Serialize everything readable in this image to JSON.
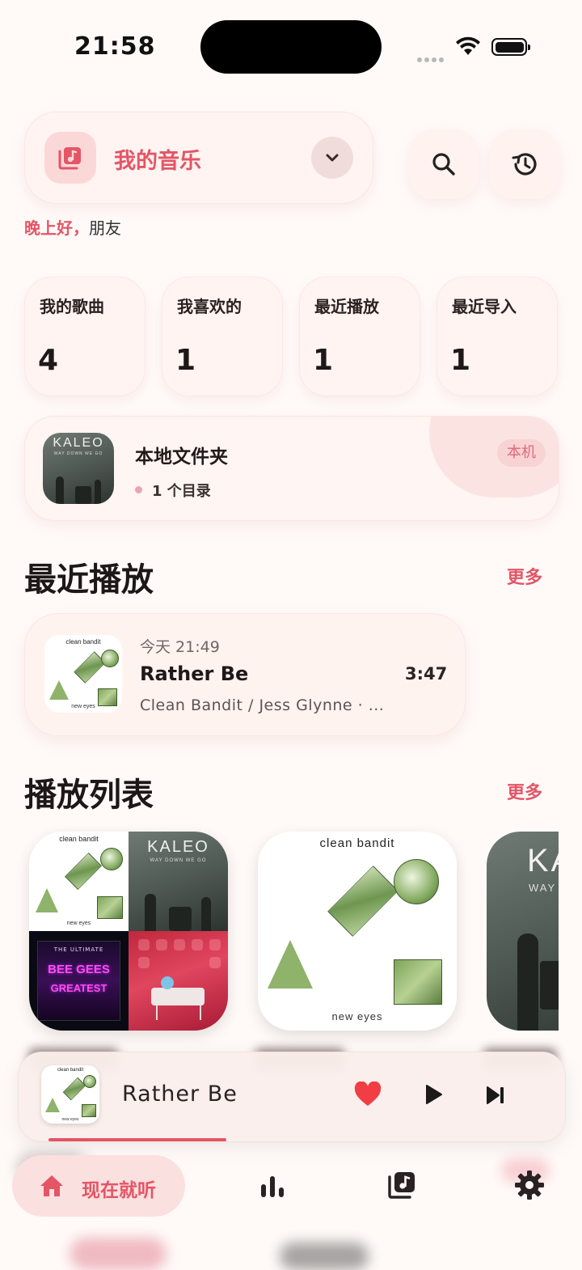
{
  "status_bar": {
    "time": "21:58"
  },
  "header": {
    "title": "我的音乐",
    "greeting_prefix": "晚上好，",
    "greeting_name": "朋友"
  },
  "stats": [
    {
      "label": "我的歌曲",
      "value": "4"
    },
    {
      "label": "我喜欢的",
      "value": "1"
    },
    {
      "label": "最近播放",
      "value": "1"
    },
    {
      "label": "最近导入",
      "value": "1"
    }
  ],
  "folder": {
    "title": "本地文件夹",
    "subtitle": "1 个目录",
    "badge": "本机",
    "cover": {
      "band": "KALEO",
      "album": "WAY DOWN WE GO"
    }
  },
  "recent_section": {
    "title": "最近播放",
    "more": "更多"
  },
  "recent_item": {
    "time": "今天 21:49",
    "title": "Rather Be",
    "duration": "3:47",
    "artist": "Clean Bandit / Jess Glynne · ...",
    "cover": {
      "top": "clean bandit",
      "bottom": "new eyes"
    }
  },
  "playlist_section": {
    "title": "播放列表",
    "more": "更多"
  },
  "playlists": {
    "card1": {
      "cb_top": "clean bandit",
      "cb_bottom": "new eyes",
      "kaleo_band": "KALEO",
      "kaleo_album": "WAY DOWN WE GO",
      "beegees_top": "THE ULTIMATE",
      "beegees_word1": "BEE GEES",
      "beegees_word2": "GREATEST"
    },
    "card2": {
      "top": "clean bandit",
      "bottom": "new eyes"
    },
    "card3": {
      "band": "KA",
      "album": "WAY"
    }
  },
  "mini_player": {
    "title": "Rather Be",
    "cover": {
      "top": "clean bandit",
      "bottom": "new eyes"
    },
    "progress": 0.28,
    "liked": true
  },
  "nav": {
    "home_label": "现在就听",
    "items": [
      "home-icon",
      "stats-icon",
      "library-icon",
      "settings-icon"
    ]
  },
  "colors": {
    "accent": "#e45566",
    "background": "#fffaf8",
    "card": "#fff4f1"
  }
}
